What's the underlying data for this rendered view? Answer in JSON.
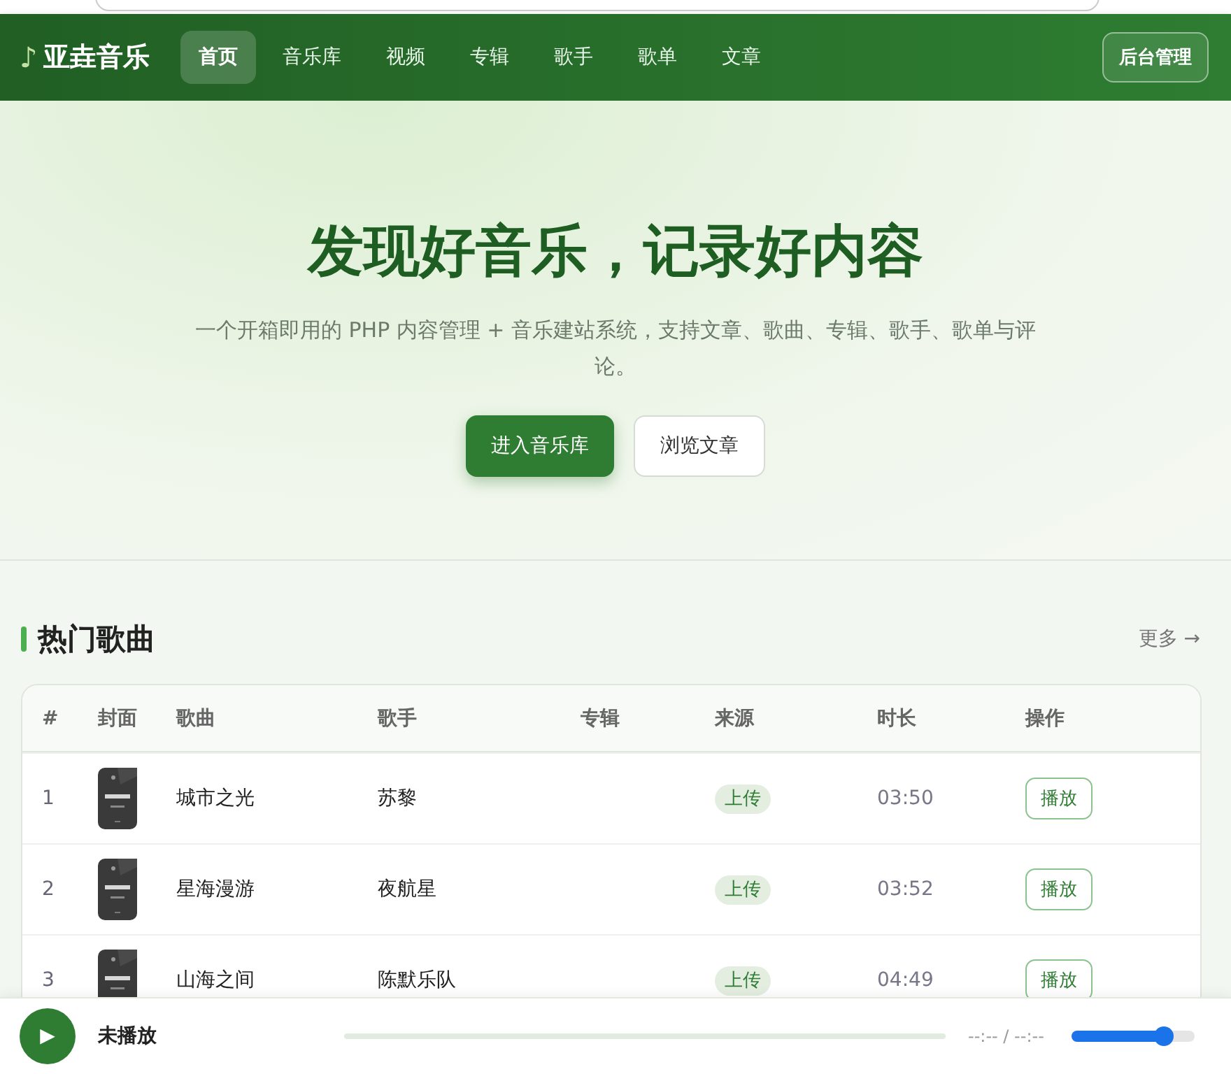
{
  "nav": {
    "logo_icon": "♪",
    "logo": "亚垚音乐",
    "items": [
      {
        "label": "首页",
        "selected": true
      },
      {
        "label": "音乐库",
        "selected": false
      },
      {
        "label": "视频",
        "selected": false
      },
      {
        "label": "专辑",
        "selected": false
      },
      {
        "label": "歌手",
        "selected": false
      },
      {
        "label": "歌单",
        "selected": false
      },
      {
        "label": "文章",
        "selected": false
      }
    ],
    "admin_button": "后台管理"
  },
  "hero": {
    "title": "发现好音乐，记录好内容",
    "subtitle": "一个开箱即用的 PHP 内容管理 + 音乐建站系统，支持文章、歌曲、专辑、歌手、歌单与评论。",
    "primary_button": "进入音乐库",
    "secondary_button": "浏览文章"
  },
  "section": {
    "title": "热门歌曲",
    "more": "更多 →"
  },
  "table": {
    "columns": [
      "#",
      "封面",
      "歌曲",
      "歌手",
      "专辑",
      "来源",
      "时长",
      "操作"
    ],
    "rows": [
      {
        "index": "1",
        "song": "城市之光",
        "artist": "苏黎",
        "source": "上传",
        "duration": "03:50",
        "action": "播放"
      },
      {
        "index": "2",
        "song": "星海漫游",
        "artist": "夜航星",
        "source": "上传",
        "duration": "03:52",
        "action": "播放"
      },
      {
        "index": "3",
        "song": "山海之间",
        "artist": "陈默乐队",
        "source": "上传",
        "duration": "04:49",
        "action": "播放"
      }
    ]
  },
  "player": {
    "play_icon": "▶",
    "status": "未播放",
    "progress": {
      "level": 0
    },
    "time": "--:-- / --:--",
    "volume": {
      "level": 0.75
    }
  }
}
